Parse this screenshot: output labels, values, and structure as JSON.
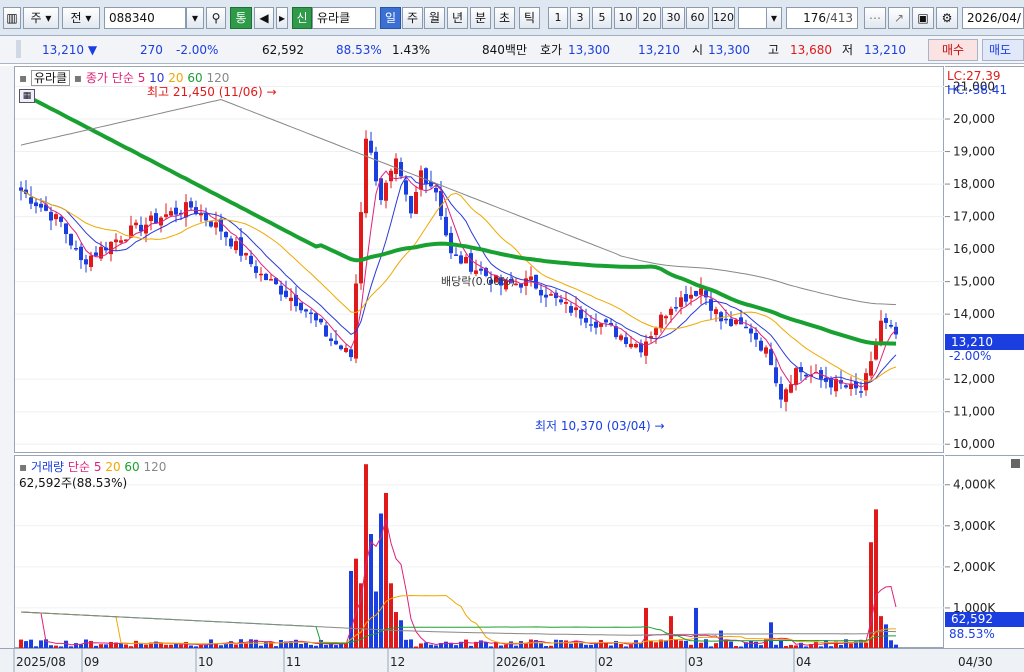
{
  "toolbar": {
    "market": "주",
    "prefix": "전",
    "stock_code": "088340",
    "tong_label": "통",
    "new_badge": "신",
    "stock_name": "유라클",
    "periods": [
      "일",
      "주",
      "월",
      "년",
      "분",
      "초",
      "틱"
    ],
    "active_period": "일",
    "intervals": [
      "1",
      "3",
      "5",
      "10",
      "20",
      "30",
      "60",
      "120"
    ],
    "count_value": "176",
    "count_total": "/413",
    "date_value": "2026/04/"
  },
  "quote": {
    "price": "13,210",
    "change_arrow": "▼",
    "change": "270",
    "change_pct": "-2.00%",
    "volume": "62,592",
    "volume_ratio": "88.53%",
    "turnover_rate": "1.43%",
    "amount": "840백만",
    "ask_label": "호가",
    "ask": "13,300",
    "bid": "13,210",
    "open_label": "시",
    "open": "13,300",
    "high_label": "고",
    "high": "13,680",
    "low_label": "저",
    "low": "13,210",
    "buy_label": "매수",
    "sell_label": "매도"
  },
  "price_legend": {
    "name": "유라클",
    "ma_label": "종가 단순",
    "ma_periods": [
      "5",
      "10",
      "20",
      "60",
      "120"
    ],
    "ma_colors": [
      "#e0207a",
      "#2a3ad8",
      "#f0a800",
      "#18a030",
      "#888888"
    ],
    "high_marker": "최고 21,450 (11/06)",
    "low_marker": "최저 10,370 (03/04)",
    "dividend_marker": "배당락(0.00%)",
    "lc": "LC:27.39",
    "hc": "HC:-38.41"
  },
  "vol_legend": {
    "name": "거래량",
    "ma_label": "단순",
    "ma_periods": [
      "5",
      "20",
      "60",
      "120"
    ],
    "volume_line": "62,592주(88.53%)"
  },
  "price_axis": {
    "ticks": [
      "21,000",
      "20,000",
      "19,000",
      "18,000",
      "17,000",
      "16,000",
      "15,000",
      "14,000",
      "12,000",
      "11,000",
      "10,000"
    ],
    "current_label": "13,210",
    "current_pct": "-2.00%"
  },
  "vol_axis": {
    "ticks": [
      "4,000K",
      "3,000K",
      "2,000K",
      "1,000K"
    ],
    "current_label": "62,592",
    "current_pct": "88.53%"
  },
  "date_axis": {
    "labels": [
      "2025/08",
      "09",
      "10",
      "11",
      "12",
      "2026/01",
      "02",
      "03",
      "04"
    ],
    "end_label": "04/30"
  },
  "colors": {
    "up": "#e01a1a",
    "down": "#1a3ee0",
    "ma60": "#18a030",
    "ma120": "#888888"
  }
}
